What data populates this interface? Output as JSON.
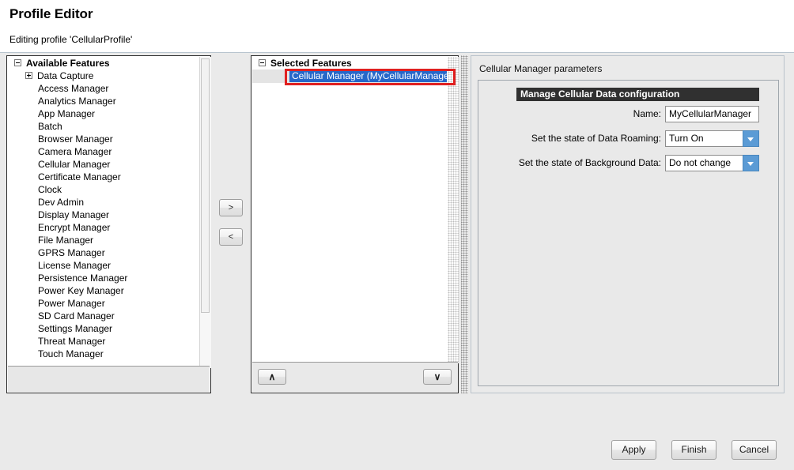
{
  "header": {
    "title": "Profile Editor",
    "subtitle": "Editing profile 'CellularProfile'"
  },
  "available_features": {
    "root_label": "Available Features",
    "expander_state": "expanded",
    "groups": [
      {
        "label": "Data Capture",
        "expander_state": "collapsed"
      }
    ],
    "items": [
      "Access Manager",
      "Analytics Manager",
      "App Manager",
      "Batch",
      "Browser Manager",
      "Camera Manager",
      "Cellular Manager",
      "Certificate Manager",
      "Clock",
      "Dev Admin",
      "Display Manager",
      "Encrypt Manager",
      "File Manager",
      "GPRS Manager",
      "License Manager",
      "Persistence Manager",
      "Power Key Manager",
      "Power Manager",
      "SD Card Manager",
      "Settings Manager",
      "Threat Manager",
      "Touch Manager"
    ]
  },
  "transfer": {
    "add_label": ">",
    "remove_label": "<"
  },
  "selected_features": {
    "root_label": "Selected Features",
    "expander_state": "expanded",
    "items": [
      {
        "label": "Cellular Manager (MyCellularManager)",
        "selected": true
      }
    ],
    "move_up_label": "∧",
    "move_down_label": "∨"
  },
  "annotation": {
    "highlight_color": "#e02020",
    "target": "Cellular Manager (MyCellularManager)"
  },
  "parameters": {
    "title": "Cellular Manager parameters",
    "section_header": "Manage Cellular Data configuration",
    "fields": [
      {
        "label": "Name:",
        "type": "text",
        "value": "MyCellularManager"
      },
      {
        "label": "Set the state of Data Roaming:",
        "type": "combo",
        "value": "Turn On"
      },
      {
        "label": "Set the state of Background Data:",
        "type": "combo",
        "value": "Do not change"
      }
    ]
  },
  "footer": {
    "apply_label": "Apply",
    "finish_label": "Finish",
    "cancel_label": "Cancel"
  },
  "colors": {
    "selection_blue": "#2667c9",
    "section_header_bg": "#303030",
    "combo_button": "#5b9bd5",
    "annotation_red": "#e02020",
    "window_bg": "#eaeaea"
  }
}
